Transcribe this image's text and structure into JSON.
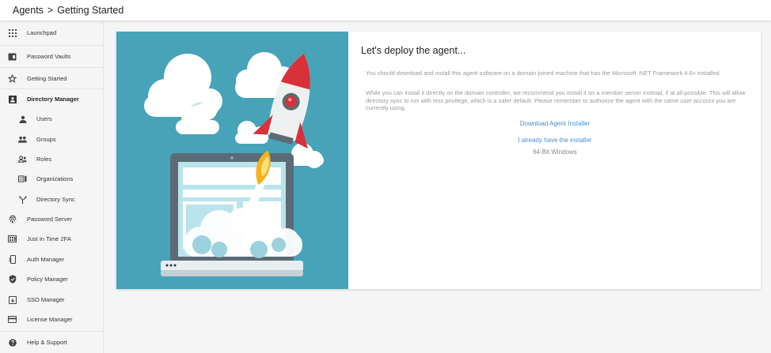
{
  "header": {
    "section": "Agents",
    "separator": ">",
    "page": "Getting Started"
  },
  "sidebar": {
    "items": [
      {
        "label": "Launchpad",
        "icon": "grid-icon"
      },
      {
        "label": "Password Vaults",
        "icon": "vault-icon"
      },
      {
        "label": "Getting Started",
        "icon": "star-icon"
      },
      {
        "label": "Directory Manager",
        "icon": "directory-icon"
      },
      {
        "label": "Users",
        "icon": "user-icon"
      },
      {
        "label": "Groups",
        "icon": "groups-icon"
      },
      {
        "label": "Roles",
        "icon": "roles-icon"
      },
      {
        "label": "Organizations",
        "icon": "organizations-icon"
      },
      {
        "label": "Directory Sync",
        "icon": "sync-icon"
      },
      {
        "label": "Password Server",
        "icon": "fingerprint-icon"
      },
      {
        "label": "Just In Time 2FA",
        "icon": "keypad-icon"
      },
      {
        "label": "Auth Manager",
        "icon": "phone-icon"
      },
      {
        "label": "Policy Manager",
        "icon": "shield-icon"
      },
      {
        "label": "SSO Manager",
        "icon": "sso-icon"
      },
      {
        "label": "License Manager",
        "icon": "license-icon"
      },
      {
        "label": "Help & Support",
        "icon": "help-icon"
      }
    ]
  },
  "main": {
    "title": "Let's deploy the agent...",
    "paragraph1": "You should download and install this agent software on a domain joined machine that has the Microsoft .NET Framework 4.6+ installed.",
    "paragraph2": "While you can install it directly on the domain controller, we recommend you install it on a member server instead, if at all possible. This will allow directory sync to run with less privilege, which is a safer default. Please remember to authorize the agent with the same user account you are currently using.",
    "download_link": "Download Agent Installer",
    "have_installer_link": "I already have the installer",
    "platform_note": "64-Bit Windows"
  },
  "colors": {
    "illustration_bg": "#47a3b8",
    "link": "#4a8fcf",
    "rocket_red": "#d8313a"
  }
}
